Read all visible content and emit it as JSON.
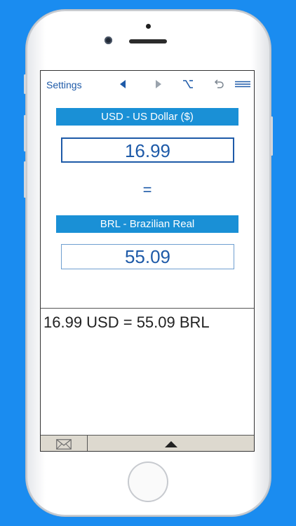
{
  "toolbar": {
    "settings_label": "Settings",
    "icons": [
      "back-triangle-icon",
      "forward-triangle-icon",
      "option-key-icon",
      "undo-icon",
      "menu-icon"
    ]
  },
  "converter": {
    "from_currency_label": "USD - US Dollar ($)",
    "from_value": "16.99",
    "equals_sign": "=",
    "to_currency_label": "BRL - Brazilian Real",
    "to_value": "55.09"
  },
  "result_text": "16.99 USD = 55.09 BRL",
  "bottom_bar": {
    "icons": [
      "mail-icon",
      "expand-up-icon"
    ]
  },
  "colors": {
    "background": "#1a8cf0",
    "accent_blue": "#1a90d6",
    "text_blue": "#1e5aa8",
    "bottom_bar": "#ddd9cf"
  }
}
